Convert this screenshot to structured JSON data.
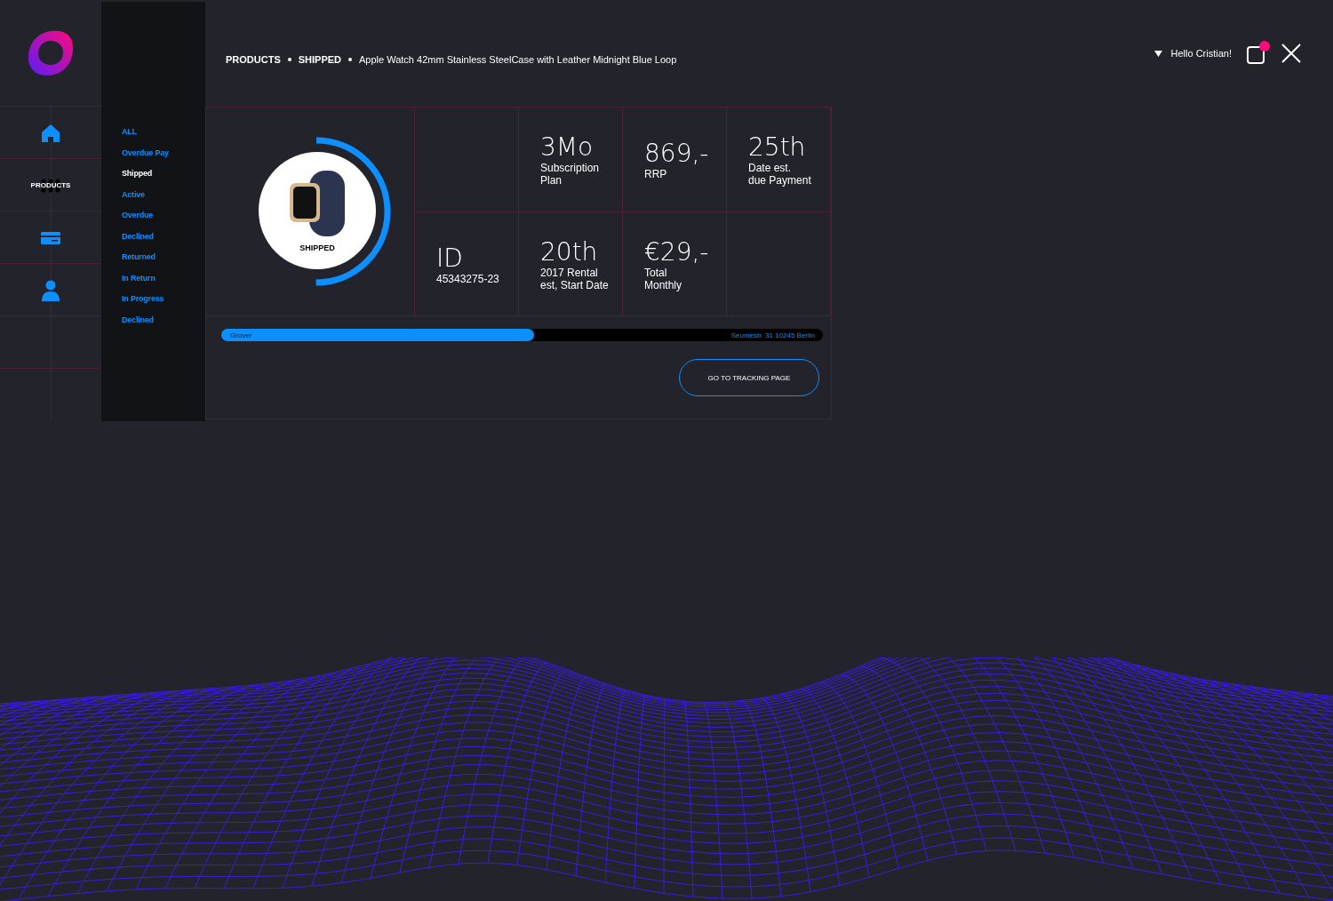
{
  "breadcrumb": [
    "PRODUCTS",
    "SHIPPED",
    "Apple Watch 42mm Stainless SteelCase  with Leather Midnight Blue Loop"
  ],
  "user": {
    "greeting": "Hello Cristian!",
    "notification": true
  },
  "nav": [
    {
      "kind": "home"
    },
    {
      "kind": "products",
      "label": "PRODUCTS"
    },
    {
      "kind": "card"
    },
    {
      "kind": "user"
    }
  ],
  "filters": [
    {
      "label": "ALL",
      "selected": false
    },
    {
      "label": "Overdue Pay",
      "selected": false
    },
    {
      "label": "Shipped",
      "selected": true
    },
    {
      "label": "Active",
      "selected": false
    },
    {
      "label": "Overdue",
      "selected": false
    },
    {
      "label": "Declined",
      "selected": false
    },
    {
      "label": "Returned",
      "selected": false
    },
    {
      "label": "In Return",
      "selected": false
    },
    {
      "label": "In Progress",
      "selected": false
    },
    {
      "label": "Declined",
      "selected": false
    }
  ],
  "product": {
    "status": "SHIPPED",
    "level": 0.5
  },
  "stats": [
    {
      "value": "3Mo",
      "label": [
        "Subscription",
        "Plan"
      ]
    },
    {
      "value": "869,-",
      "label": [
        "RRP"
      ]
    },
    {
      "value": "25th",
      "label": [
        "Date est.",
        "due Payment"
      ]
    },
    {
      "value": "ID",
      "label": [
        "45343275-23"
      ]
    },
    {
      "value": "20th",
      "label": [
        "2017 Rental",
        "est, Start Date"
      ]
    },
    {
      "value": "€29,-",
      "label": [
        "Total",
        "Monthly"
      ]
    }
  ],
  "tracking": {
    "from": "Grover",
    "to": "Seumestr. 31 10245 Berlin",
    "level": 0.52
  },
  "button": "GO TO TRACKING PAGE"
}
